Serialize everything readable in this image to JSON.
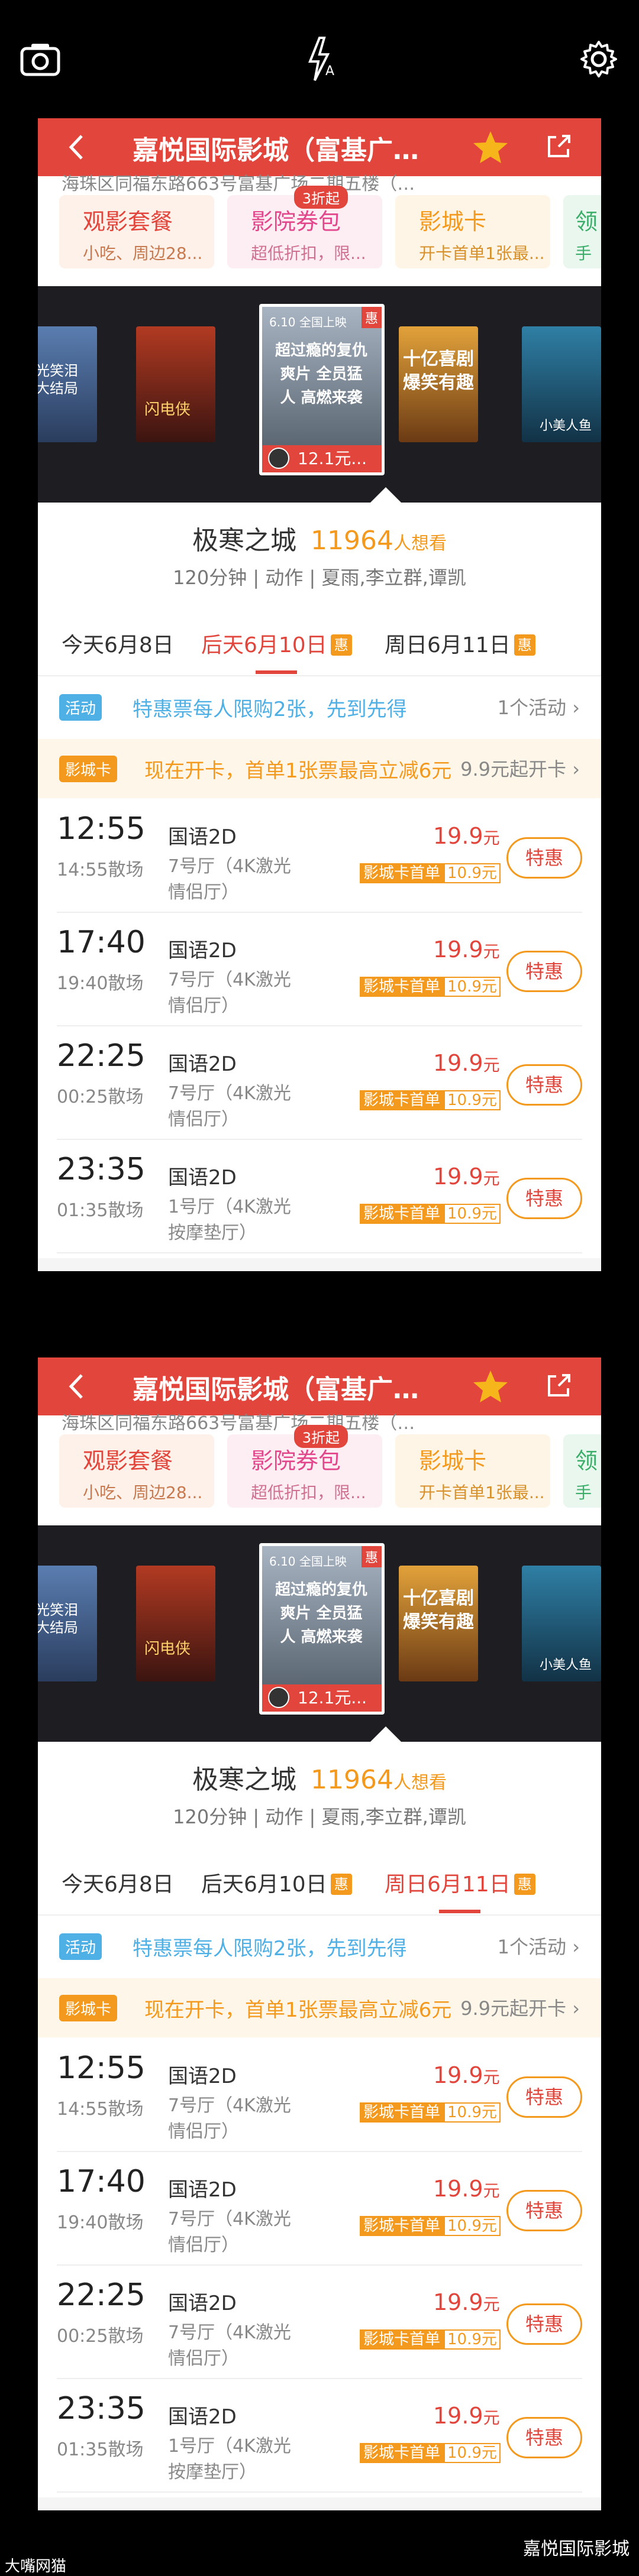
{
  "camera": {
    "icons": [
      "camera-icon",
      "flash-auto-icon",
      "settings-gear-icon"
    ],
    "flash_label": "A"
  },
  "cinema": {
    "title": "嘉悦国际影城（富基广…",
    "address": "海珠区同福东路663号富基广场二期五楼（…"
  },
  "promos": [
    {
      "title": "观影套餐",
      "sub": "小吃、周边28...",
      "tag": ""
    },
    {
      "title": "影院券包",
      "sub": "超低折扣，限...",
      "tag": "3折起"
    },
    {
      "title": "影城卡",
      "sub": "开卡首单1张最...",
      "tag": ""
    },
    {
      "title": "领",
      "sub": "手",
      "tag": ""
    }
  ],
  "posters": [
    {
      "label": "月光笑泪 一大结局",
      "color": "#3a5a86"
    },
    {
      "label": "闪电侠",
      "color": "#7a2c1e"
    },
    {
      "label": "超过瘾的复仇爽片 全员猛人 高燃来袭",
      "sub": "12.1元...",
      "badge": "惠",
      "date": "6.10 全国上映",
      "color": "#8a96a6"
    },
    {
      "label": "十亿喜剧 爆笑有趣",
      "color": "#c7762a"
    },
    {
      "label": "小美人鱼",
      "color": "#1f5d7e"
    }
  ],
  "movie": {
    "name": "极寒之城",
    "wish_count": "11964",
    "wish_label": "人想看",
    "meta": "120分钟 | 动作 | 夏雨,李立群,谭凯"
  },
  "panels": [
    {
      "days": [
        {
          "label": "今天6月8日",
          "badge": ""
        },
        {
          "label": "后天6月10日",
          "badge": "惠"
        },
        {
          "label": "周日6月11日",
          "badge": "惠"
        }
      ],
      "active_day": 1
    },
    {
      "days": [
        {
          "label": "今天6月8日",
          "badge": ""
        },
        {
          "label": "后天6月10日",
          "badge": "惠"
        },
        {
          "label": "周日6月11日",
          "badge": "惠"
        }
      ],
      "active_day": 2
    }
  ],
  "activity": {
    "badge": "活动",
    "text": "特惠票每人限购2张，先到先得",
    "right": "1个活动"
  },
  "card_row": {
    "badge": "影城卡",
    "text": "现在开卡，首单1张票最高立减6元",
    "right": "9.9元起开卡"
  },
  "showtimes": [
    {
      "time": "12:55",
      "end": "14:55散场",
      "lang": "国语2D",
      "hall": "7号厅（4K激光情侣厅）",
      "price": "19.9",
      "unit": "元",
      "card_label": "影城卡首单",
      "card_price": "10.9元",
      "button": "特惠"
    },
    {
      "time": "17:40",
      "end": "19:40散场",
      "lang": "国语2D",
      "hall": "7号厅（4K激光情侣厅）",
      "price": "19.9",
      "unit": "元",
      "card_label": "影城卡首单",
      "card_price": "10.9元",
      "button": "特惠"
    },
    {
      "time": "22:25",
      "end": "00:25散场",
      "lang": "国语2D",
      "hall": "7号厅（4K激光情侣厅）",
      "price": "19.9",
      "unit": "元",
      "card_label": "影城卡首单",
      "card_price": "10.9元",
      "button": "特惠"
    },
    {
      "time": "23:35",
      "end": "01:35散场",
      "lang": "国语2D",
      "hall": "1号厅（4K激光按摩垫厅）",
      "price": "19.9",
      "unit": "元",
      "card_label": "影城卡首单",
      "card_price": "10.9元",
      "button": "特惠"
    }
  ],
  "footer": {
    "left": "大嘴网猫",
    "right": "嘉悦国际影城"
  },
  "colors": {
    "brand": "#e1453b",
    "accent": "#f39a1e",
    "activity": "#4fb0e6"
  }
}
